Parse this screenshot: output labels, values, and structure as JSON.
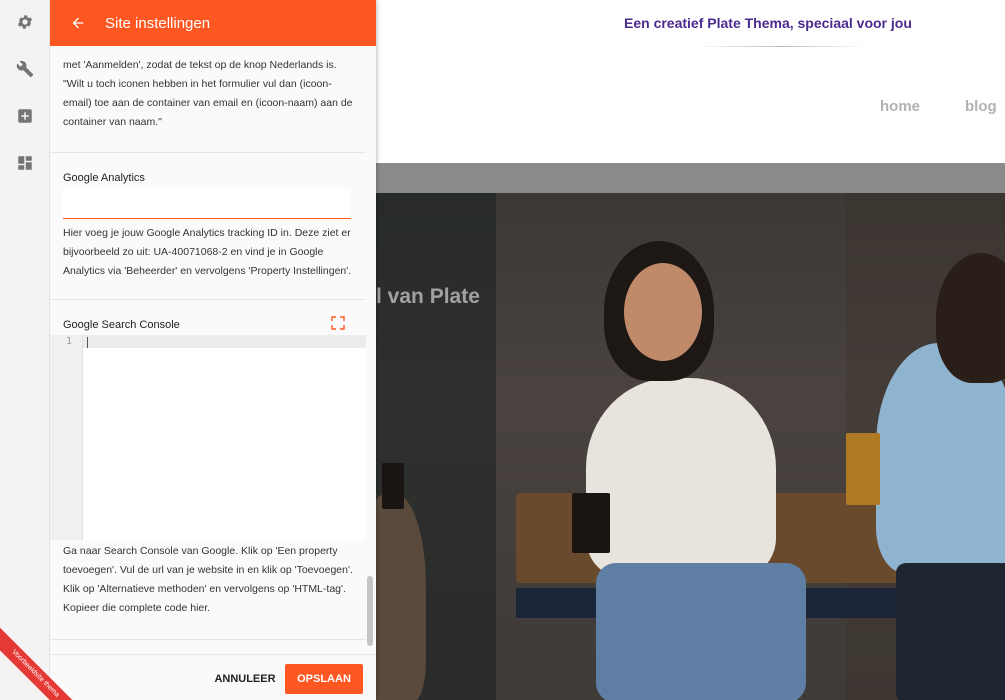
{
  "rail": {
    "items": [
      {
        "icon": "gear-icon"
      },
      {
        "icon": "wrench-icon"
      },
      {
        "icon": "plus-box-icon"
      },
      {
        "icon": "dashboard-icon"
      }
    ]
  },
  "badge": {
    "text": "Voorbeeldsite thema"
  },
  "panel": {
    "title": "Site instellingen",
    "intro_help": "met 'Aanmelden', zodat de tekst op de knop Nederlands is. \"Wilt u toch iconen hebben in het formulier vul dan (icoon-email) toe aan de container van email en (icoon-naam) aan de container van naam.\"",
    "ga": {
      "label": "Google Analytics",
      "value": "",
      "placeholder": "",
      "help": "Hier voeg je jouw Google Analytics tracking ID in. Deze ziet er bijvoorbeeld zo uit: UA-40071068-2 en vind je in Google Analytics via 'Beheerder' en vervolgens 'Property Instellingen'."
    },
    "gsc": {
      "label": "Google Search Console",
      "line_number": "1",
      "help": "Ga naar Search Console van Google. Klik op 'Een property toevoegen'. Vul de url van je website in en klik op 'Toevoegen'. Klik op 'Alternatieve methoden' en vervolgens op 'HTML-tag'. Kopieer die complete code hier."
    },
    "footer": {
      "cancel_label": "ANNULEER",
      "save_label": "OPSLAAN"
    }
  },
  "preview": {
    "tagline": "Een creatief Plate Thema, speciaal voor jou",
    "nav": [
      "home",
      "blog"
    ],
    "hero_text": "l van Plate"
  },
  "colors": {
    "accent": "#ff5722",
    "tagline": "#4a2b8f"
  }
}
